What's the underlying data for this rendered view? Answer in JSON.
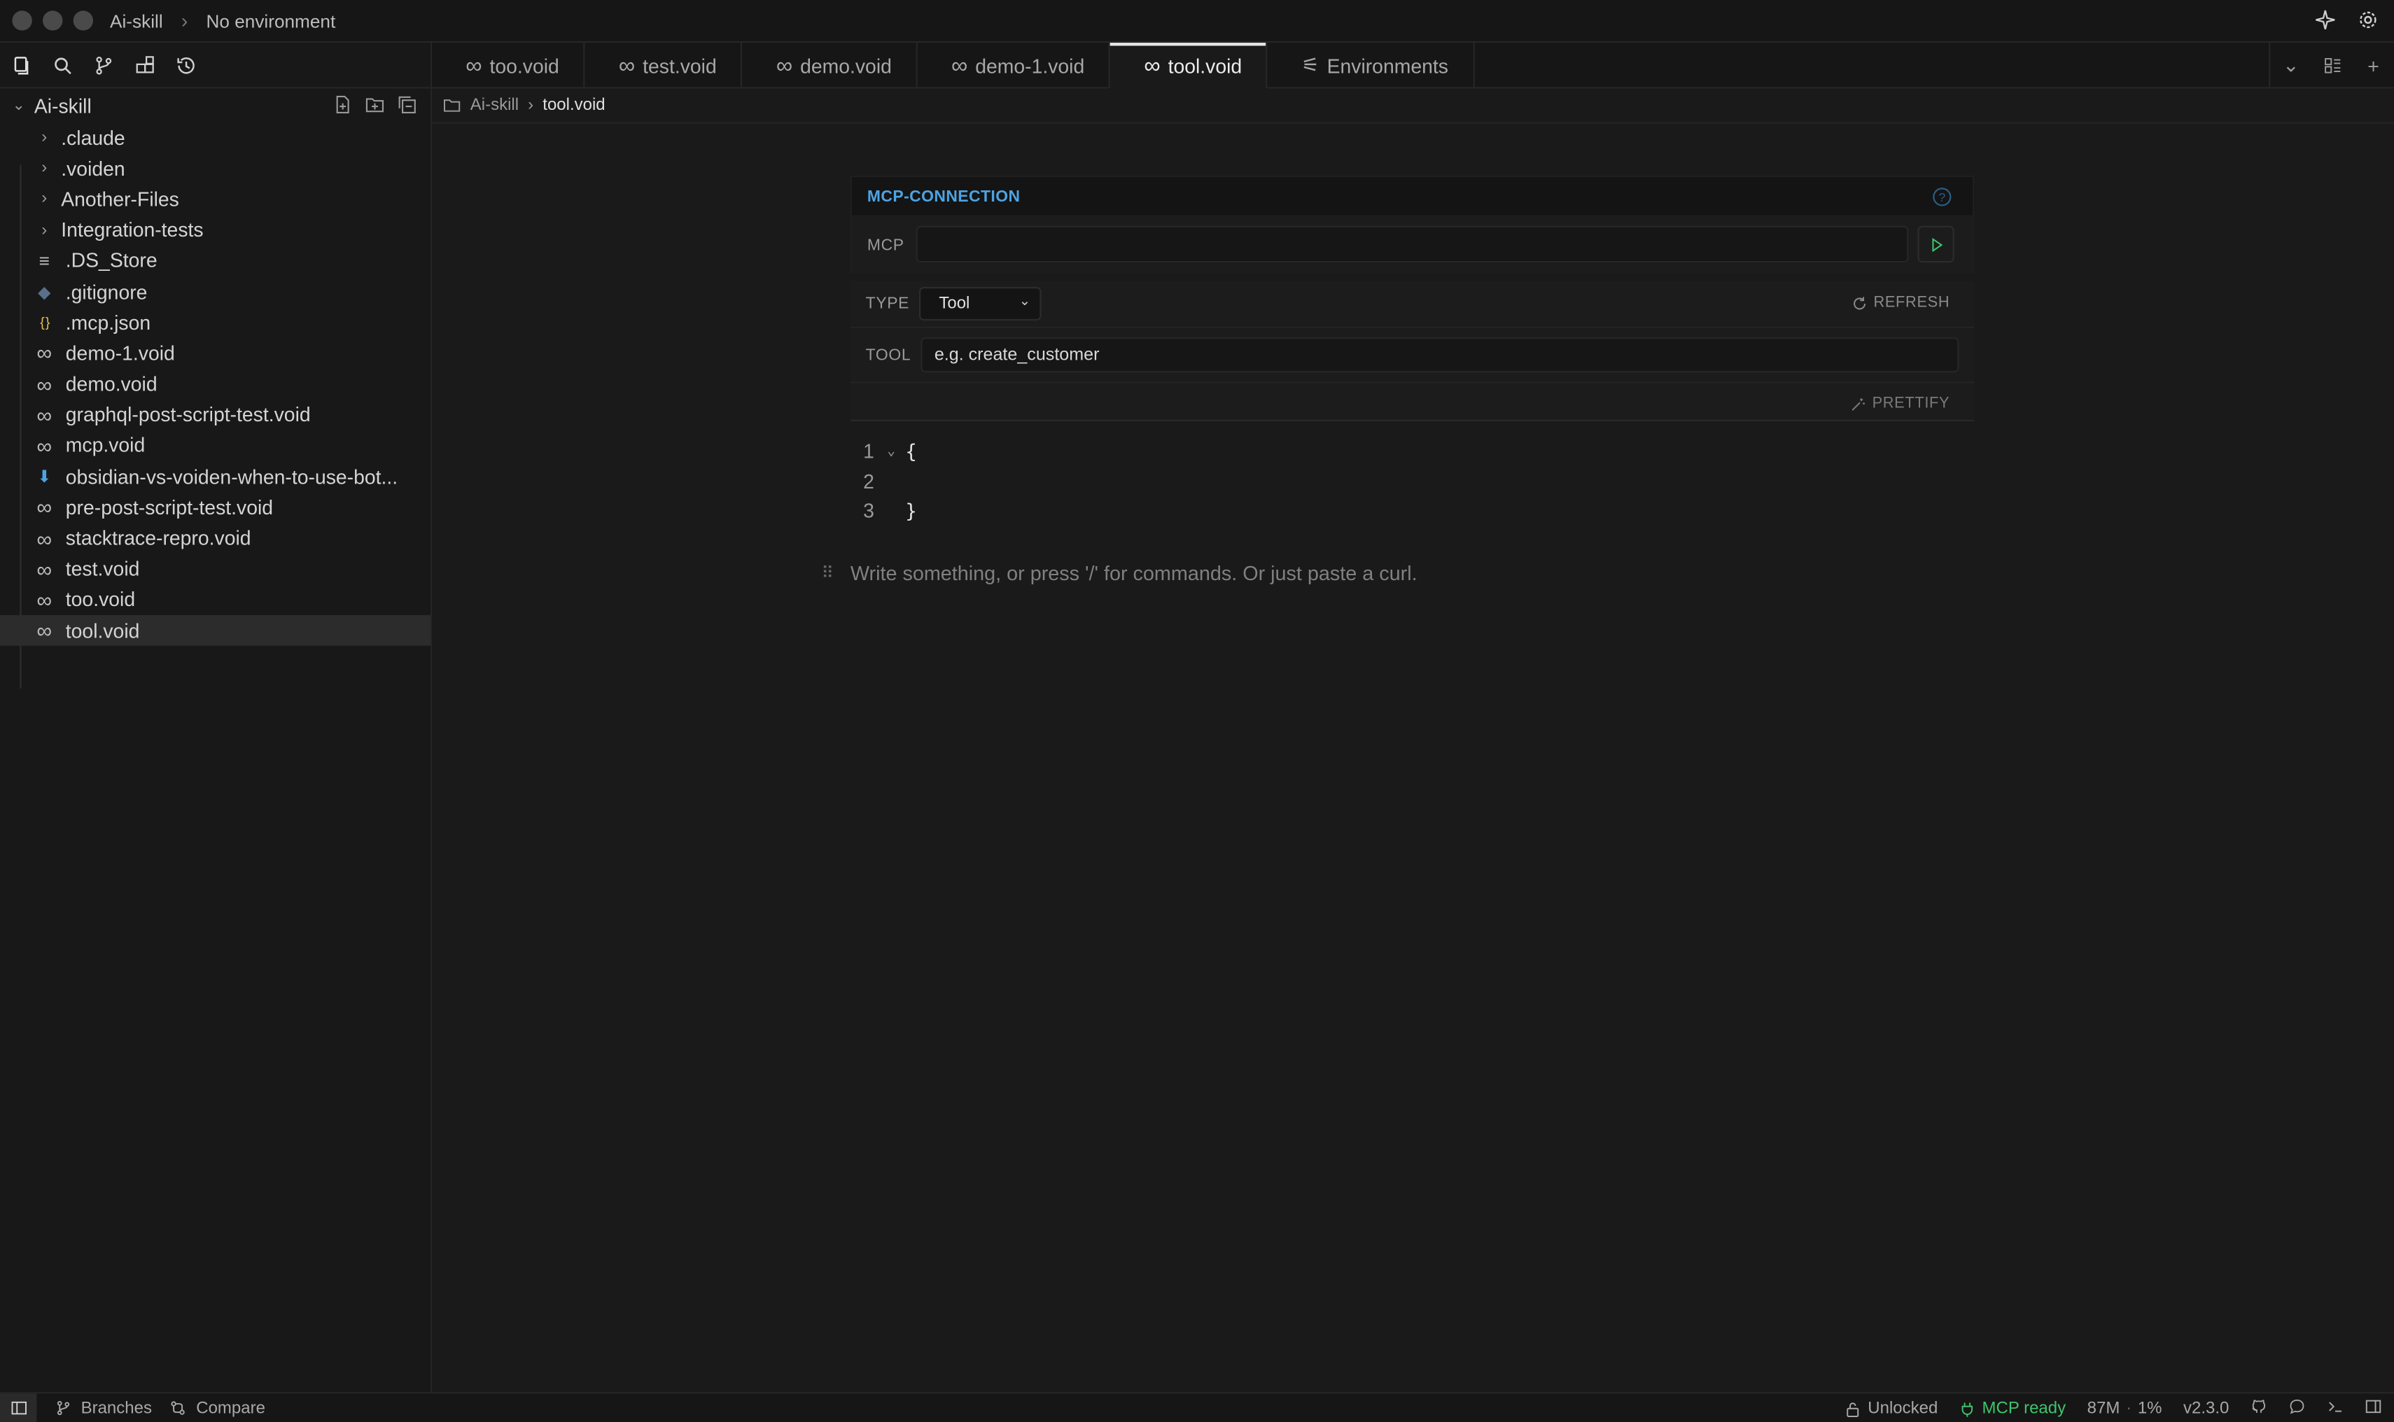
{
  "titlebar": {
    "project": "Ai-skill",
    "environment": "No environment"
  },
  "sidebar": {
    "project_name": "Ai-skill",
    "items": [
      {
        "label": ".claude",
        "kind": "folder",
        "icon": "chevron-right-icon"
      },
      {
        "label": ".voiden",
        "kind": "folder",
        "icon": "chevron-right-icon"
      },
      {
        "label": "Another-Files",
        "kind": "folder",
        "icon": "chevron-right-icon"
      },
      {
        "label": "Integration-tests",
        "kind": "folder",
        "icon": "chevron-right-icon"
      },
      {
        "label": ".DS_Store",
        "kind": "file",
        "icon": "lines-file-icon"
      },
      {
        "label": ".gitignore",
        "kind": "file",
        "icon": "git-diamond-icon"
      },
      {
        "label": ".mcp.json",
        "kind": "file",
        "icon": "json-braces-icon"
      },
      {
        "label": "demo-1.void",
        "kind": "file",
        "icon": "infinity-icon"
      },
      {
        "label": "demo.void",
        "kind": "file",
        "icon": "infinity-icon"
      },
      {
        "label": "graphql-post-script-test.void",
        "kind": "file",
        "icon": "infinity-icon"
      },
      {
        "label": "mcp.void",
        "kind": "file",
        "icon": "infinity-icon"
      },
      {
        "label": "obsidian-vs-voiden-when-to-use-bot...",
        "kind": "file",
        "icon": "markdown-arrow-icon"
      },
      {
        "label": "pre-post-script-test.void",
        "kind": "file",
        "icon": "infinity-icon"
      },
      {
        "label": "stacktrace-repro.void",
        "kind": "file",
        "icon": "infinity-icon"
      },
      {
        "label": "test.void",
        "kind": "file",
        "icon": "infinity-icon"
      },
      {
        "label": "too.void",
        "kind": "file",
        "icon": "infinity-icon"
      },
      {
        "label": "tool.void",
        "kind": "file",
        "icon": "infinity-icon",
        "active": true
      }
    ]
  },
  "tabs": [
    {
      "label": "too.void",
      "icon": "infinity-icon"
    },
    {
      "label": "test.void",
      "icon": "infinity-icon"
    },
    {
      "label": "demo.void",
      "icon": "infinity-icon"
    },
    {
      "label": "demo-1.void",
      "icon": "infinity-icon"
    },
    {
      "label": "tool.void",
      "icon": "infinity-icon",
      "active": true
    },
    {
      "label": "Environments",
      "icon": "sliders-icon"
    }
  ],
  "breadcrumb": {
    "root": "Ai-skill",
    "current": "tool.void"
  },
  "mcp_panel": {
    "title": "MCP-CONNECTION",
    "mcp_label": "MCP",
    "mcp_value": "",
    "type_label": "TYPE",
    "type_value": "Tool",
    "refresh_label": "REFRESH",
    "tool_label": "TOOL",
    "tool_placeholder": "e.g. create_customer",
    "prettify_label": "PRETTIFY"
  },
  "code": {
    "lines": [
      {
        "num": "1",
        "text": "{"
      },
      {
        "num": "2",
        "text": ""
      },
      {
        "num": "3",
        "text": "}"
      }
    ]
  },
  "editor": {
    "placeholder": "Write something, or press '/' for commands. Or just paste a curl."
  },
  "statusbar": {
    "branches": "Branches",
    "compare": "Compare",
    "lock": "Unlocked",
    "mcp_status": "MCP ready",
    "memory": "87M",
    "separator": "·",
    "cpu": "1%",
    "version": "v2.3.0"
  },
  "colors": {
    "accent_blue": "#4da3e3",
    "status_green": "#3ec46d",
    "run_green": "#3ec46d"
  }
}
